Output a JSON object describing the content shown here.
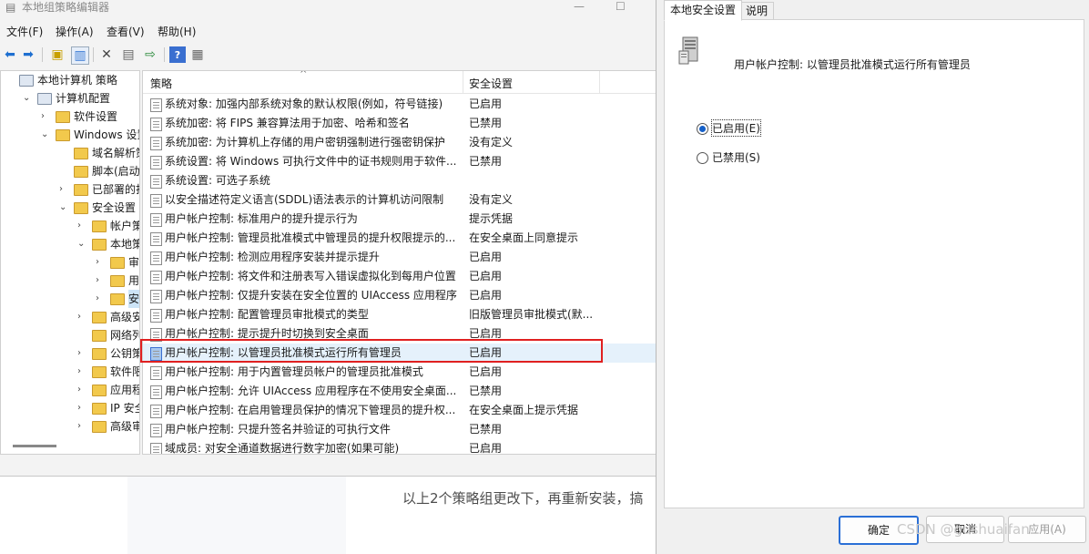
{
  "window": {
    "title": "本地组策略编辑器",
    "controls": [
      "—",
      "☐"
    ]
  },
  "menu": [
    "文件(F)",
    "操作(A)",
    "查看(V)",
    "帮助(H)"
  ],
  "tree": [
    {
      "label": "本地计算机 策略",
      "chev": "",
      "level": 0
    },
    {
      "label": "计算机配置",
      "chev": "⌄",
      "level": 1
    },
    {
      "label": "软件设置",
      "chev": "›",
      "level": 2
    },
    {
      "label": "Windows 设置",
      "chev": "⌄",
      "level": 2
    },
    {
      "label": "域名解析策",
      "chev": "",
      "level": 3
    },
    {
      "label": "脚本(启动/",
      "chev": "",
      "level": 3
    },
    {
      "label": "已部署的打",
      "chev": "›",
      "level": 3
    },
    {
      "label": "安全设置",
      "chev": "⌄",
      "level": 3
    },
    {
      "label": "帐户策",
      "chev": "›",
      "level": 4
    },
    {
      "label": "本地策",
      "chev": "⌄",
      "level": 4
    },
    {
      "label": "审核",
      "chev": "›",
      "level": 5
    },
    {
      "label": "用户",
      "chev": "›",
      "level": 5
    },
    {
      "label": "安全",
      "chev": "›",
      "level": 5
    },
    {
      "label": "高级安",
      "chev": "›",
      "level": 4
    },
    {
      "label": "网络列",
      "chev": "",
      "level": 4
    },
    {
      "label": "公钥策",
      "chev": "›",
      "level": 4
    },
    {
      "label": "软件限",
      "chev": "›",
      "level": 4
    },
    {
      "label": "应用程",
      "chev": "›",
      "level": 4
    },
    {
      "label": "IP 安全",
      "chev": "›",
      "level": 4
    },
    {
      "label": "高级审",
      "chev": "›",
      "level": 4
    }
  ],
  "list": {
    "col_policy": "策略",
    "col_setting": "安全设置",
    "rows": [
      {
        "policy": "系统对象: 加强内部系统对象的默认权限(例如，符号链接)",
        "setting": "已启用"
      },
      {
        "policy": "系统加密: 将 FIPS 兼容算法用于加密、哈希和签名",
        "setting": "已禁用"
      },
      {
        "policy": "系统加密: 为计算机上存储的用户密钥强制进行强密钥保护",
        "setting": "没有定义"
      },
      {
        "policy": "系统设置: 将 Windows 可执行文件中的证书规则用于软件...",
        "setting": "已禁用"
      },
      {
        "policy": "系统设置: 可选子系统",
        "setting": ""
      },
      {
        "policy": "以安全描述符定义语言(SDDL)语法表示的计算机访问限制",
        "setting": "没有定义"
      },
      {
        "policy": "用户帐户控制: 标准用户的提升提示行为",
        "setting": "提示凭据"
      },
      {
        "policy": "用户帐户控制: 管理员批准模式中管理员的提升权限提示的...",
        "setting": "在安全桌面上同意提示"
      },
      {
        "policy": "用户帐户控制: 检测应用程序安装并提示提升",
        "setting": "已启用"
      },
      {
        "policy": "用户帐户控制: 将文件和注册表写入错误虚拟化到每用户位置",
        "setting": "已启用"
      },
      {
        "policy": "用户帐户控制: 仅提升安装在安全位置的 UIAccess 应用程序",
        "setting": "已启用"
      },
      {
        "policy": "用户帐户控制:    配置管理员审批模式的类型",
        "setting": "旧版管理员审批模式(默..."
      },
      {
        "policy": "用户帐户控制: 提示提升时切换到安全桌面",
        "setting": "已启用"
      },
      {
        "policy": "用户帐户控制: 以管理员批准模式运行所有管理员",
        "setting": "已启用"
      },
      {
        "policy": "用户帐户控制: 用于内置管理员帐户的管理员批准模式",
        "setting": "已启用"
      },
      {
        "policy": "用户帐户控制: 允许 UIAccess 应用程序在不使用安全桌面...",
        "setting": "已禁用"
      },
      {
        "policy": "用户帐户控制: 在启用管理员保护的情况下管理员的提升权...",
        "setting": "在安全桌面上提示凭据"
      },
      {
        "policy": "用户帐户控制: 只提升签名并验证的可执行文件",
        "setting": "已禁用"
      },
      {
        "policy": "域成员: 对安全通道数据进行数字加密(如果可能)",
        "setting": "已启用"
      }
    ]
  },
  "background_page": {
    "text": "以上2个策略组更改下，再重新安装，搞"
  },
  "dialog": {
    "tab_active": "本地安全设置",
    "tab_other": "说明",
    "policy_name": "用户帐户控制: 以管理员批准模式运行所有管理员",
    "radio_enabled": "已启用(E)",
    "radio_disabled": "已禁用(S)",
    "enabled_selected": true,
    "ok": "确定",
    "cancel": "取消",
    "apply": "应用(A)"
  },
  "watermark": "CSDN @gushuaifan",
  "colors": {
    "highlight_box": "#e02020",
    "radio_selected": "#1560c8",
    "primary_button_border": "#2a6fd6"
  }
}
